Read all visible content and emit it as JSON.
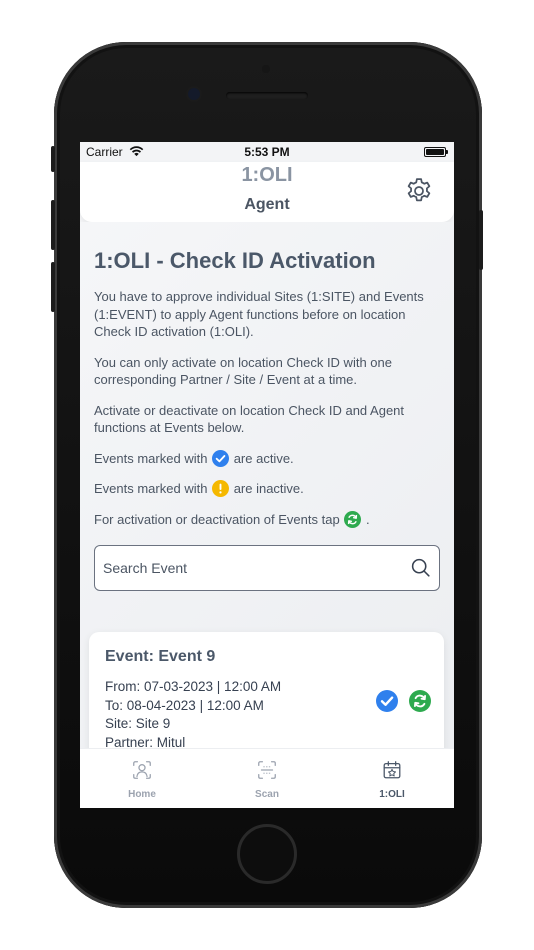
{
  "status_bar": {
    "carrier": "Carrier",
    "time": "5:53 PM"
  },
  "header": {
    "logo": "1:OLI",
    "subtitle": "Agent"
  },
  "main": {
    "title": "1:OLI - Check ID Activation",
    "para1": "You have to approve individual Sites (1:SITE) and Events (1:EVENT) to apply Agent functions before on location Check ID activation (1:OLI).",
    "para2": "You can only activate on location Check ID with one corresponding Partner / Site / Event at a time.",
    "para3": "Activate or deactivate on location Check ID and Agent functions at Events below.",
    "para4_before": "Events marked with",
    "para4_after": "are active.",
    "para5_before": "Events marked with",
    "para5_after": "are inactive.",
    "para6_before": "For activation or deactivation of Events tap",
    "para6_after": "."
  },
  "search": {
    "placeholder": "Search Event",
    "value": ""
  },
  "event": {
    "title": "Event: Event 9",
    "from": "From: 07-03-2023 | 12:00 AM",
    "to": "To: 08-04-2023 | 12:00 AM",
    "site": "Site: Site 9",
    "partner": "Partner: Mitul"
  },
  "tabs": [
    {
      "label": "Home",
      "icon": "user-scan-icon",
      "active": false
    },
    {
      "label": "Scan",
      "icon": "scan-frame-icon",
      "active": false
    },
    {
      "label": "1:OLI",
      "icon": "calendar-star-icon",
      "active": true
    }
  ],
  "colors": {
    "active_blue": "#2f80ed",
    "sync_green": "#2eaa4f",
    "warning_yellow": "#f5b800",
    "title_slate": "#4b5869"
  }
}
